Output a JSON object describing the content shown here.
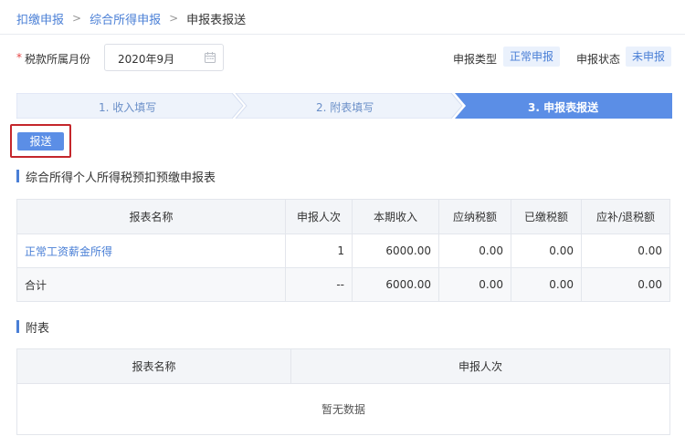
{
  "breadcrumb": {
    "items": [
      "扣缴申报",
      "综合所得申报"
    ],
    "current": "申报表报送",
    "separator": ">"
  },
  "form": {
    "required_mark": "*",
    "month_label": "税款所属月份",
    "month_value": "2020年9月",
    "declare_type_label": "申报类型",
    "declare_type_value": "正常申报",
    "declare_status_label": "申报状态",
    "declare_status_value": "未申报"
  },
  "steps": [
    {
      "label": "1. 收入填写",
      "active": false
    },
    {
      "label": "2. 附表填写",
      "active": false
    },
    {
      "label": "3. 申报表报送",
      "active": true
    }
  ],
  "submit_button": "报送",
  "main_table": {
    "title": "综合所得个人所得税预扣预缴申报表",
    "columns": [
      "报表名称",
      "申报人次",
      "本期收入",
      "应纳税额",
      "已缴税额",
      "应补/退税额"
    ],
    "rows": [
      {
        "name": "正常工资薪金所得",
        "count": "1",
        "income": "6000.00",
        "tax_due": "0.00",
        "tax_paid": "0.00",
        "tax_refund": "0.00"
      },
      {
        "name": "合计",
        "count": "--",
        "income": "6000.00",
        "tax_due": "0.00",
        "tax_paid": "0.00",
        "tax_refund": "0.00"
      }
    ]
  },
  "attach_table": {
    "title": "附表",
    "columns": [
      "报表名称",
      "申报人次"
    ],
    "empty_text": "暂无数据"
  },
  "colors": {
    "accent": "#4a7fd6",
    "step_active": "#5b8ee6",
    "highlight_border": "#c4262b"
  }
}
